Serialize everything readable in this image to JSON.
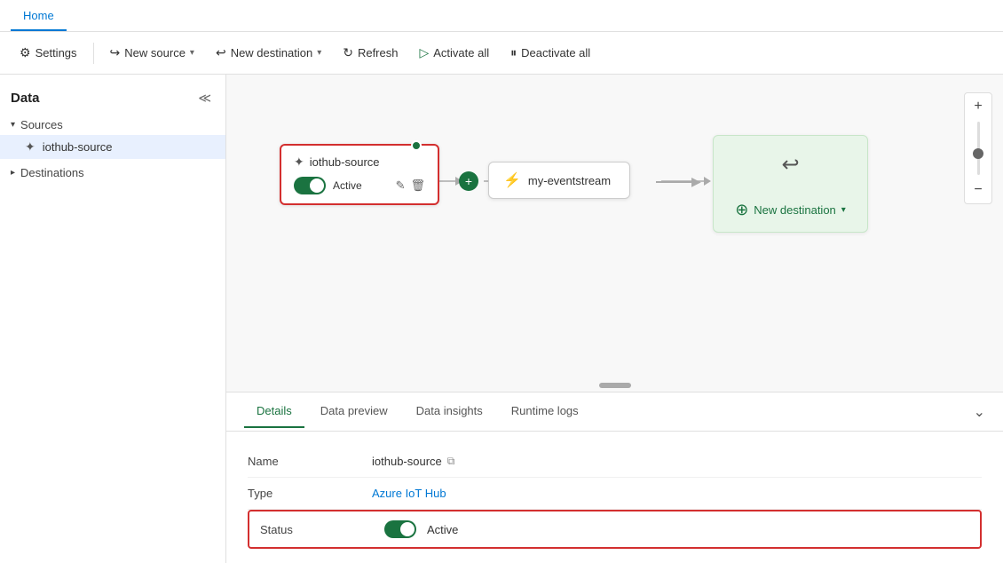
{
  "tabs": [
    {
      "id": "home",
      "label": "Home",
      "active": true
    }
  ],
  "toolbar": {
    "settings_label": "Settings",
    "new_source_label": "New source",
    "new_destination_label": "New destination",
    "refresh_label": "Refresh",
    "activate_all_label": "Activate all",
    "deactivate_all_label": "Deactivate all"
  },
  "sidebar": {
    "title": "Data",
    "sections": [
      {
        "id": "sources",
        "label": "Sources",
        "expanded": true,
        "items": [
          {
            "id": "iothub-source",
            "label": "iothub-source",
            "active": true
          }
        ]
      },
      {
        "id": "destinations",
        "label": "Destinations",
        "expanded": false,
        "items": []
      }
    ]
  },
  "flow": {
    "source_node": {
      "title": "iothub-source",
      "toggle_state": "active",
      "toggle_label": "Active"
    },
    "eventstream_node": {
      "title": "my-eventstream"
    },
    "destination_node": {
      "new_destination_label": "New destination"
    }
  },
  "details": {
    "tabs": [
      {
        "id": "details",
        "label": "Details",
        "active": true
      },
      {
        "id": "data-preview",
        "label": "Data preview",
        "active": false
      },
      {
        "id": "data-insights",
        "label": "Data insights",
        "active": false
      },
      {
        "id": "runtime-logs",
        "label": "Runtime logs",
        "active": false
      }
    ],
    "fields": [
      {
        "id": "name",
        "label": "Name",
        "value": "iothub-source",
        "type": "copy"
      },
      {
        "id": "type",
        "label": "Type",
        "value": "Azure IoT Hub",
        "type": "link"
      },
      {
        "id": "status",
        "label": "Status",
        "value": "Active",
        "type": "toggle",
        "highlighted": true
      }
    ]
  }
}
